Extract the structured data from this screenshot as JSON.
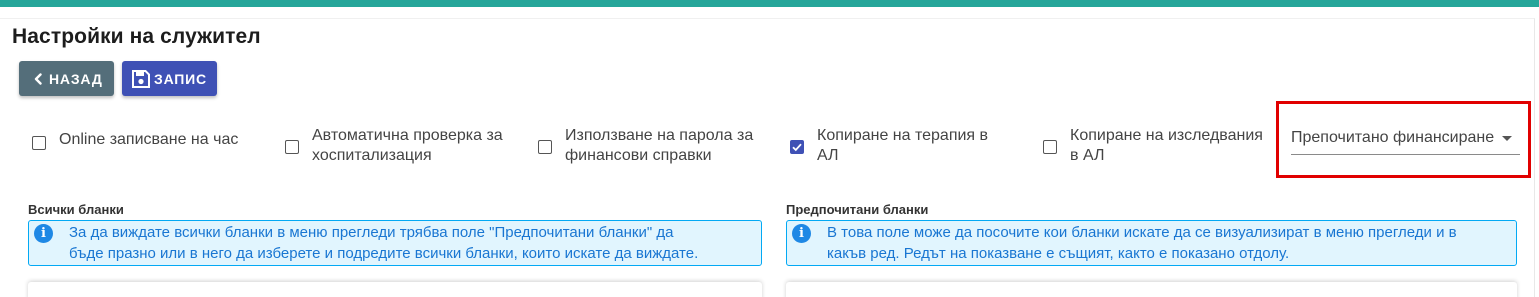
{
  "colors": {
    "topbar": "#26a69a",
    "back_button": "#546e7a",
    "save_button": "#3f51b5",
    "checkbox_checked": "#3f51b5",
    "highlight_border": "#e10000",
    "info_background": "#e1f5fe",
    "info_text": "#1976d2"
  },
  "page": {
    "title": "Настройки на служител"
  },
  "toolbar": {
    "back_label": "НАЗАД",
    "back_icon": "chevron-left-icon",
    "save_label": "ЗАПИС",
    "save_icon": "floppy-disk-icon"
  },
  "options": [
    {
      "label_line1": "Online записване на час",
      "label_line2": "",
      "checked": false
    },
    {
      "label_line1": "Автоматична проверка за",
      "label_line2": "хоспитализация",
      "checked": false
    },
    {
      "label_line1": "Използване на парола за",
      "label_line2": "финансови справки",
      "checked": false
    },
    {
      "label_line1": "Копиране на терапия в",
      "label_line2": "АЛ",
      "checked": true
    },
    {
      "label_line1": "Копиране на изследвания",
      "label_line2": "в АЛ",
      "checked": false
    }
  ],
  "financing_select": {
    "value": "Препочитано финансиране",
    "icon": "caret-down-icon"
  },
  "all_forms": {
    "label": "Всички бланки",
    "info_line1": "За да виждате всички бланки в меню прегледи трябва поле \"Предпочитани бланки\" да",
    "info_line2": "бъде празно или в него да изберете и подредите всички бланки, които искате да виждате.",
    "info_icon": "info-icon"
  },
  "preferred_forms": {
    "label": "Предпочитани бланки",
    "info_line1": "В това поле може да посочите кои бланки искате да се визуализират в меню прегледи и в",
    "info_line2": "какъв ред. Редът на показване е същият, както е показано отдолу.",
    "info_icon": "info-icon"
  }
}
